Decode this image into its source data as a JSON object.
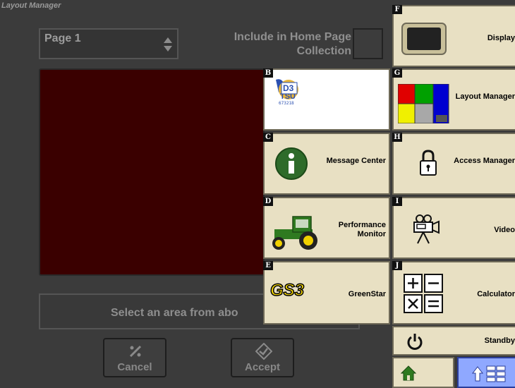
{
  "window": {
    "title": "Layout Manager"
  },
  "page_select": {
    "value": "Page 1"
  },
  "include_home": {
    "label": "Include in Home Page Collection"
  },
  "hint": {
    "text": "Select an area from abo"
  },
  "buttons": {
    "cancel": "Cancel",
    "accept": "Accept"
  },
  "menu": {
    "tiles": [
      {
        "letter": "B",
        "label": "",
        "icon": "d3-tsu-logo",
        "logo_text": "D3",
        "logo_sub": "TSU",
        "logo_num": "673218"
      },
      {
        "letter": "C",
        "label": "Message Center",
        "icon": "info-icon"
      },
      {
        "letter": "D",
        "label": "Performance Monitor",
        "icon": "tractor-icon"
      },
      {
        "letter": "E",
        "label": "GreenStar",
        "icon": "gs3-logo",
        "logo_text": "GS3"
      },
      {
        "letter": "F",
        "label": "Display",
        "icon": "display-icon"
      },
      {
        "letter": "G",
        "label": "Layout Manager",
        "icon": "layout-grid-icon"
      },
      {
        "letter": "H",
        "label": "Access Manager",
        "icon": "padlock-icon"
      },
      {
        "letter": "I",
        "label": "Video",
        "icon": "video-camera-icon"
      },
      {
        "letter": "J",
        "label": "Calculator",
        "icon": "calculator-icon"
      }
    ],
    "standby": "Standby"
  },
  "colors": {
    "tile_bg": "#e8e0c3",
    "preview_bg": "#3a0000",
    "accent_blue": "#8fa8ff",
    "info_green": "#2e6b2a",
    "tractor_green": "#2f7a20",
    "tractor_yellow": "#f0d000"
  }
}
